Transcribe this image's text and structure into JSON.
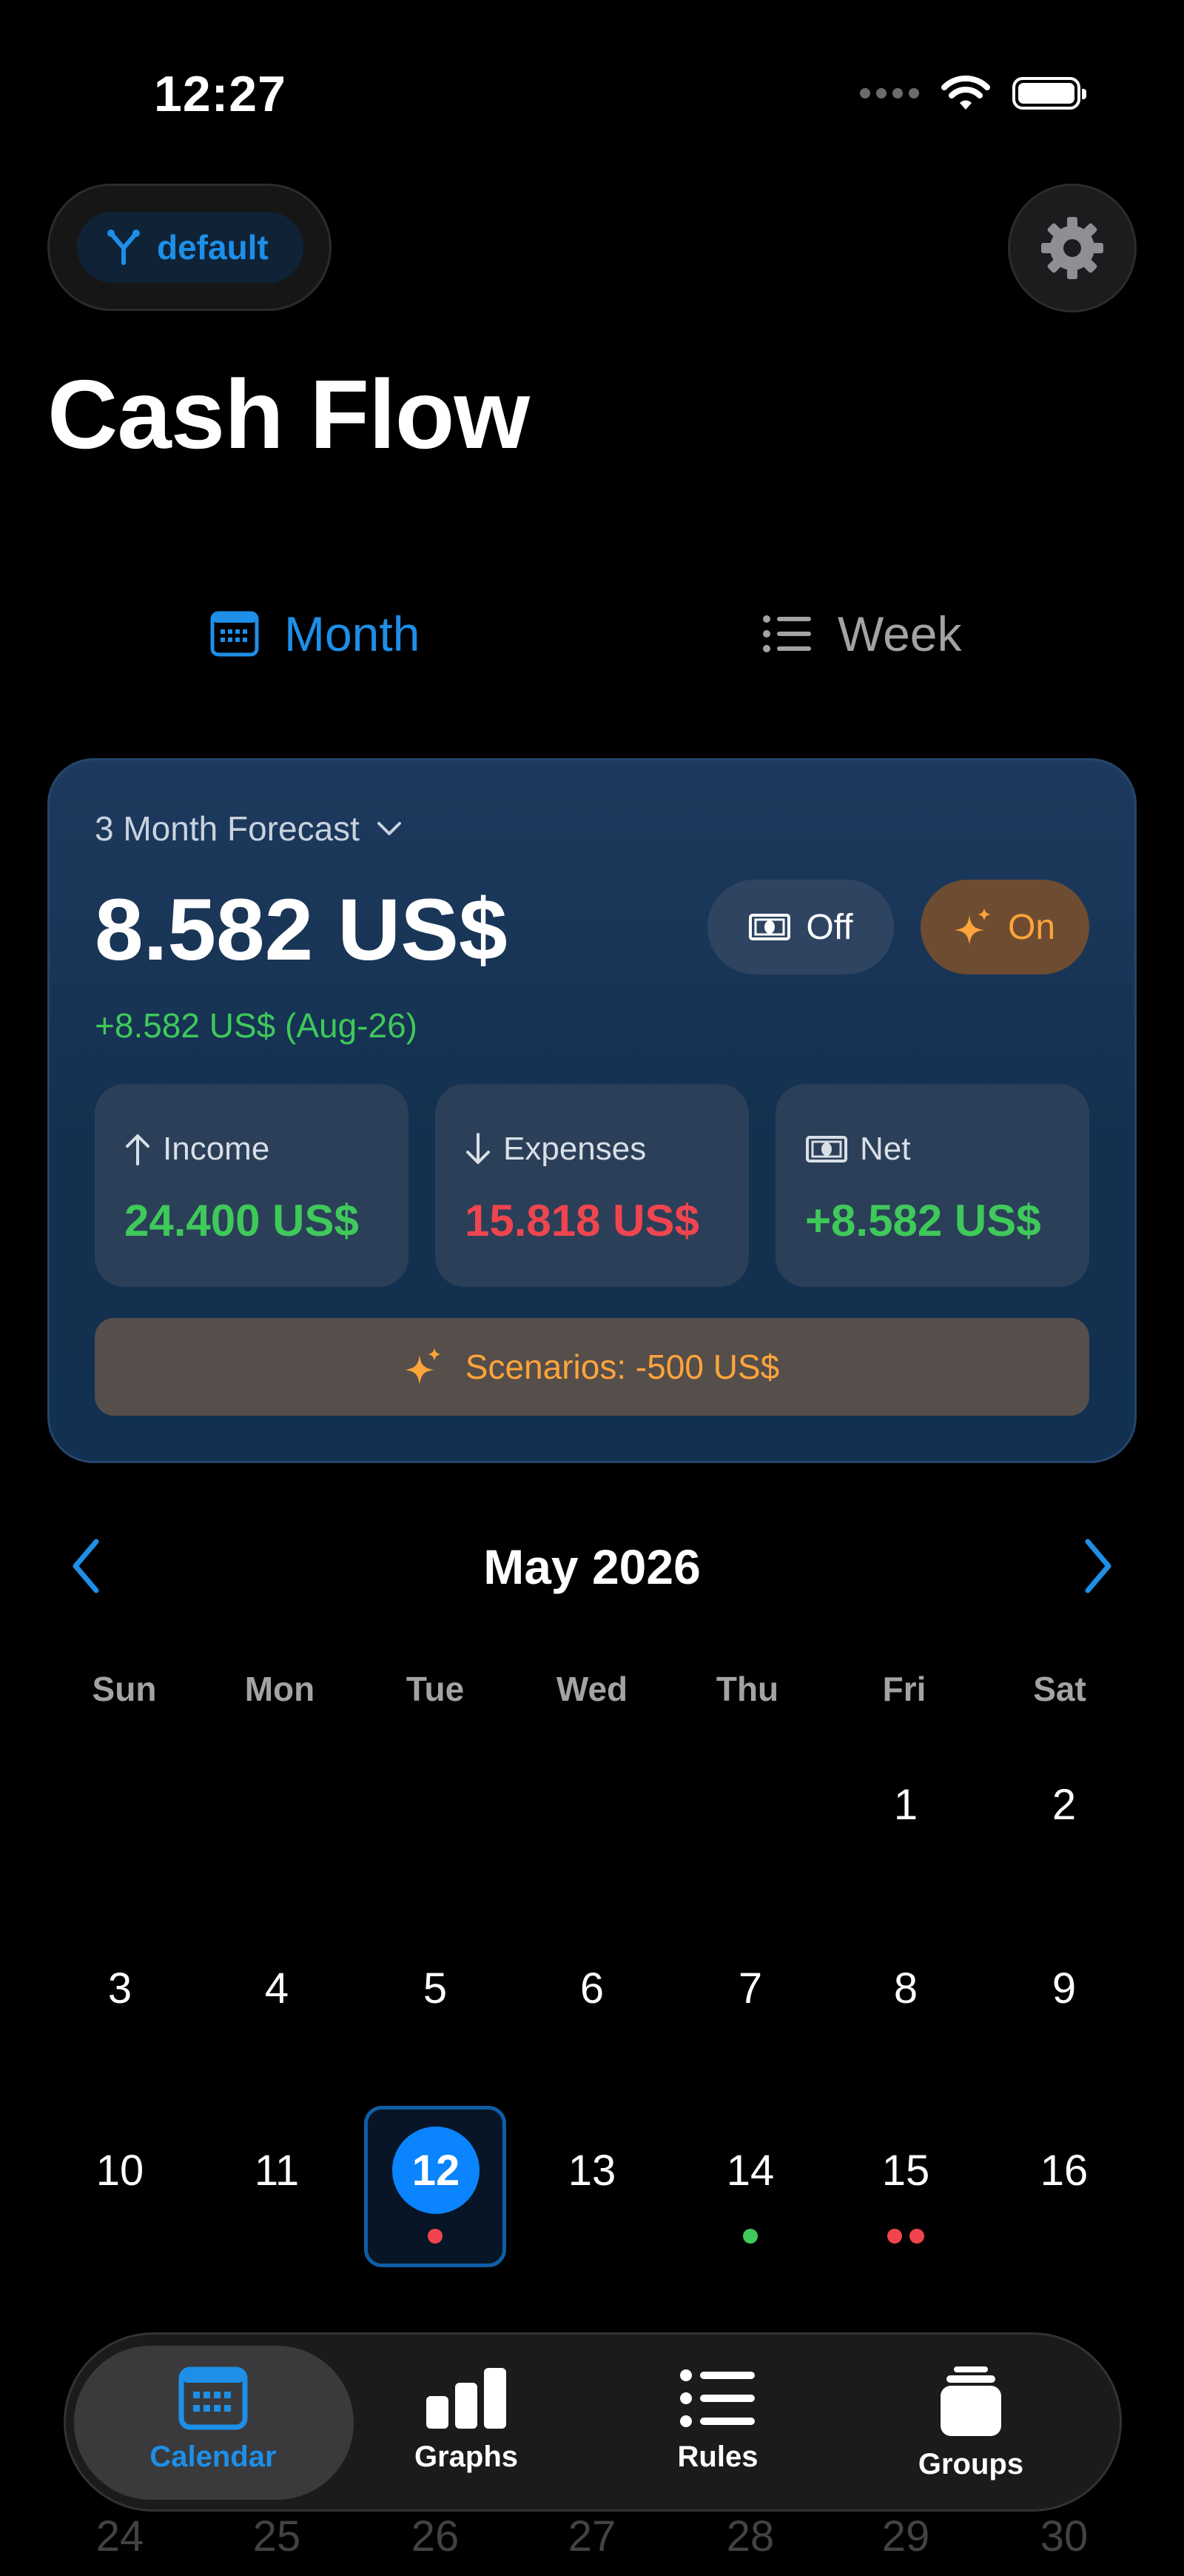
{
  "status_bar": {
    "time": "12:27"
  },
  "header": {
    "branch_label": "default",
    "title": "Cash Flow"
  },
  "view_switch": {
    "month": "Month",
    "week": "Week",
    "selected": "Month"
  },
  "forecast": {
    "label": "3 Month Forecast",
    "amount": "8.582 US$",
    "delta": "+8.582 US$ (Aug-26)",
    "toggle_off": "Off",
    "toggle_on": "On",
    "income_label": "Income",
    "income_value": "24.400 US$",
    "expenses_label": "Expenses",
    "expenses_value": "15.818 US$",
    "net_label": "Net",
    "net_value": "+8.582 US$",
    "scenarios": "Scenarios: -500 US$"
  },
  "calendar": {
    "month_title": "May 2026",
    "weekdays": [
      "Sun",
      "Mon",
      "Tue",
      "Wed",
      "Thu",
      "Fri",
      "Sat"
    ],
    "days": [
      "1",
      "2",
      "3",
      "4",
      "5",
      "6",
      "7",
      "8",
      "9",
      "10",
      "11",
      "12",
      "13",
      "14",
      "15",
      "16"
    ],
    "selected_day": "12",
    "partial_row": [
      "24",
      "25",
      "26",
      "27",
      "28",
      "29",
      "30"
    ],
    "markers": {
      "12": [
        "red"
      ],
      "14": [
        "green"
      ],
      "15": [
        "red",
        "red"
      ]
    }
  },
  "colors": {
    "accent": "#0a84ff",
    "income": "#3fc95a",
    "expense": "#f0454f",
    "scenario": "#ffa43a"
  },
  "tabs": [
    {
      "label": "Calendar",
      "icon": "calendar-icon",
      "active": true
    },
    {
      "label": "Graphs",
      "icon": "bar-chart-icon",
      "active": false
    },
    {
      "label": "Rules",
      "icon": "list-icon",
      "active": false
    },
    {
      "label": "Groups",
      "icon": "stack-icon",
      "active": false
    }
  ]
}
